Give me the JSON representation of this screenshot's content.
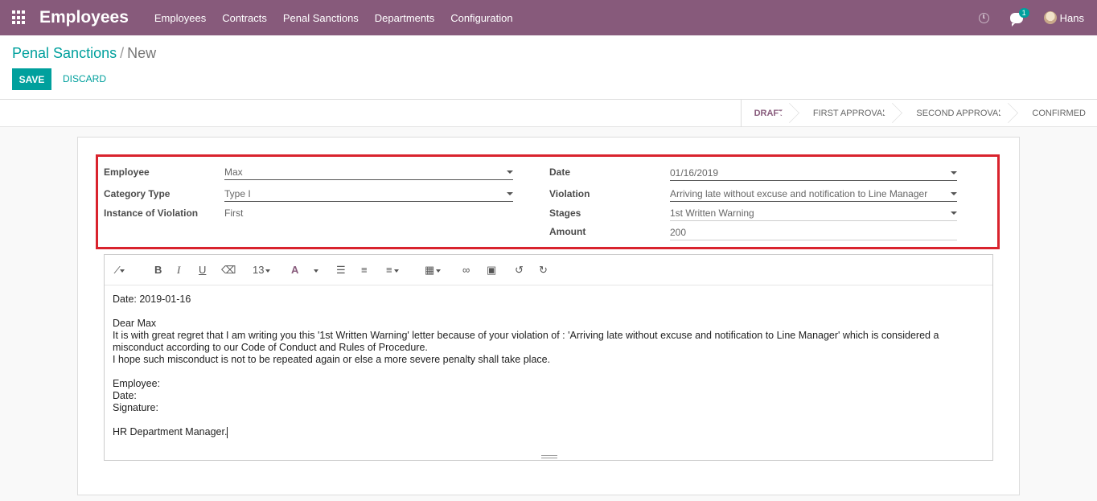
{
  "navbar": {
    "app_title": "Employees",
    "menu": [
      "Employees",
      "Contracts",
      "Penal Sanctions",
      "Departments",
      "Configuration"
    ],
    "chat_count": "1",
    "user_name": "Hans"
  },
  "breadcrumb": {
    "parent": "Penal Sanctions",
    "separator": "/",
    "current": "New"
  },
  "buttons": {
    "save": "SAVE",
    "discard": "DISCARD"
  },
  "stages": [
    "DRAFT",
    "FIRST APPROVAL",
    "SECOND APPROVAL",
    "CONFIRMED"
  ],
  "active_stage": "DRAFT",
  "form": {
    "employee_label": "Employee",
    "employee_value": "Max",
    "category_label": "Category Type",
    "category_value": "Type I",
    "instance_label": "Instance of Violation",
    "instance_value": "First",
    "date_label": "Date",
    "date_value": "01/16/2019",
    "violation_label": "Violation",
    "violation_value": "Arriving late without excuse and notification to Line Manager",
    "stages_label": "Stages",
    "stages_value": "1st Written Warning",
    "amount_label": "Amount",
    "amount_value": "200"
  },
  "editor": {
    "font_size": "13",
    "toolbar_icons": [
      "magic-wand-icon",
      "bold-icon",
      "italic-icon",
      "underline-icon",
      "eraser-icon",
      "font-size-select",
      "font-color-icon",
      "unordered-list-icon",
      "ordered-list-icon",
      "align-icon",
      "table-icon",
      "link-icon",
      "image-icon",
      "undo-icon",
      "redo-icon"
    ],
    "lines": {
      "date": "Date: 2019-01-16",
      "greeting": "Dear Max",
      "p1": "It is with great regret that I am writing you this '1st Written Warning' letter because of your violation of : 'Arriving late without excuse and notification to Line Manager' which is considered a",
      "p2": "misconduct according to our Code of Conduct and Rules of Procedure.",
      "p3": "I hope such misconduct is not to be repeated again or else a more severe penalty shall take place.",
      "employee": "Employee:",
      "date2": "Date:",
      "signature": "Signature:",
      "manager": "HR Department Manager."
    }
  },
  "colors": {
    "brand": "#875a7b",
    "accent": "#00a09d",
    "highlight": "#d9232d"
  }
}
